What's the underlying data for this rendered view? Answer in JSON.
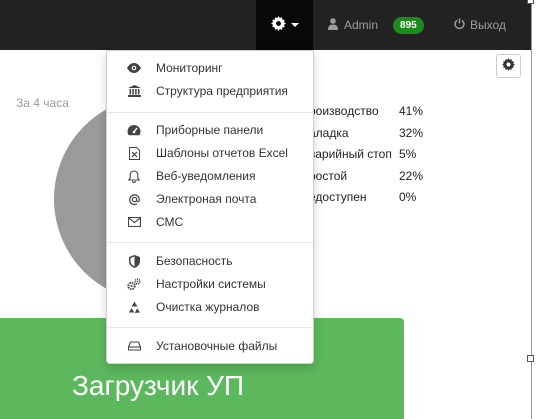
{
  "navbar": {
    "settings_icon": "gear-icon",
    "user": {
      "icon": "user-icon",
      "name": "Admin",
      "badge": "895"
    },
    "logout": {
      "icon": "power-icon",
      "label": "Выход"
    }
  },
  "panel": {
    "settings_icon": "gear-icon",
    "period": "За 4 часа",
    "legend": [
      {
        "name": "роизводство",
        "value": "41%"
      },
      {
        "name": "аладка",
        "value": "32%"
      },
      {
        "name": "варийный стоп",
        "value": "5%"
      },
      {
        "name": "ростой",
        "value": "22%"
      },
      {
        "name": "едоступен",
        "value": "0%"
      }
    ],
    "upload_label": "Загрузчик УП"
  },
  "menu": {
    "items": [
      {
        "icon": "eye-icon",
        "label": "Мониторинг"
      },
      {
        "icon": "building-icon",
        "label": "Структура предприятия"
      },
      {
        "icon": "dashboard-icon",
        "label": "Приборные панели"
      },
      {
        "icon": "excel-file-icon",
        "label": "Шаблоны отчетов Excel"
      },
      {
        "icon": "bell-icon",
        "label": "Веб-уведомления"
      },
      {
        "icon": "at-icon",
        "label": "Электроная почта"
      },
      {
        "icon": "envelope-icon",
        "label": "СМС"
      },
      {
        "icon": "shield-icon",
        "label": "Безопасность"
      },
      {
        "icon": "gears-icon",
        "label": "Настройки системы"
      },
      {
        "icon": "recycle-icon",
        "label": "Очистка журналов"
      },
      {
        "icon": "hdd-icon",
        "label": "Установочные файлы"
      }
    ]
  },
  "colors": {
    "navbar": "#222222",
    "badge": "#1c8a1c",
    "upload_button": "#5cb85c",
    "pie_blue": "#62a8e6",
    "pie_red": "#e84a5a",
    "pie_gray": "#9a9a9a"
  }
}
